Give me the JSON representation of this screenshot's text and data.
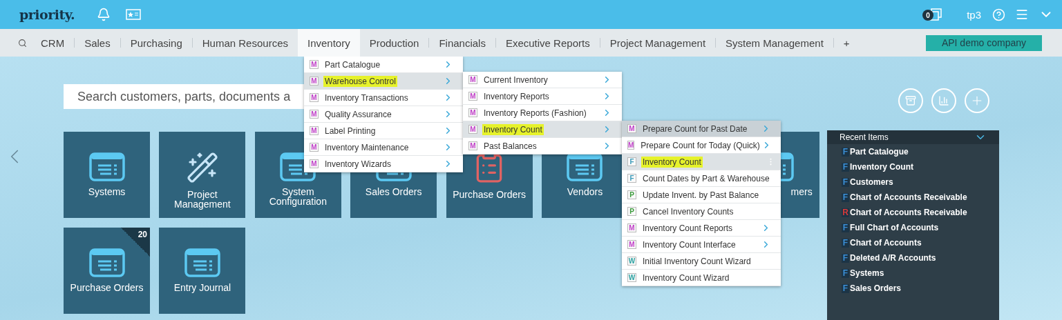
{
  "top_bar": {
    "logo": "priority.",
    "notifications": "0",
    "user": "tp3"
  },
  "nav": {
    "items": [
      {
        "label": "CRM",
        "selected": false
      },
      {
        "label": "Sales",
        "selected": false
      },
      {
        "label": "Purchasing",
        "selected": false
      },
      {
        "label": "Human Resources",
        "selected": false
      },
      {
        "label": "Inventory",
        "selected": true
      },
      {
        "label": "Production",
        "selected": false
      },
      {
        "label": "Financials",
        "selected": false
      },
      {
        "label": "Executive Reports",
        "selected": false
      },
      {
        "label": "Project Management",
        "selected": false
      },
      {
        "label": "System Management",
        "selected": false
      },
      {
        "label": "+",
        "selected": false
      }
    ],
    "company": "API demo company"
  },
  "search": {
    "placeholder": "Search customers, parts, documents a"
  },
  "tiles": [
    {
      "label": "Systems",
      "kind": "list"
    },
    {
      "label": "Project Management",
      "kind": "wand"
    },
    {
      "label": "System Configuration",
      "kind": "list"
    },
    {
      "label": "Sales Orders",
      "kind": "list"
    },
    {
      "label": "Purchase Orders",
      "kind": "checklist"
    },
    {
      "label": "Vendors",
      "kind": "list"
    },
    {
      "label": "mers",
      "kind": "clipped"
    },
    {
      "label": "Purchase Orders",
      "kind": "list",
      "badge": "20"
    },
    {
      "label": "Entry Journal",
      "kind": "list"
    }
  ],
  "recent": {
    "title": "Recent Items",
    "items": [
      {
        "tag": "F",
        "color": "#3b8fd6",
        "label": "Part Catalogue"
      },
      {
        "tag": "F",
        "color": "#3b8fd6",
        "label": "Inventory Count"
      },
      {
        "tag": "F",
        "color": "#3b8fd6",
        "label": "Customers"
      },
      {
        "tag": "F",
        "color": "#3b8fd6",
        "label": "Chart of Accounts Receivable"
      },
      {
        "tag": "R",
        "color": "#d83a3a",
        "label": "Chart of Accounts Receivable"
      },
      {
        "tag": "F",
        "color": "#3b8fd6",
        "label": "Full Chart of Accounts"
      },
      {
        "tag": "F",
        "color": "#3b8fd6",
        "label": "Chart of Accounts"
      },
      {
        "tag": "F",
        "color": "#3b8fd6",
        "label": "Deleted A/R Accounts"
      },
      {
        "tag": "F",
        "color": "#3b8fd6",
        "label": "Systems"
      },
      {
        "tag": "F",
        "color": "#3b8fd6",
        "label": "Sales Orders"
      }
    ]
  },
  "menus": [
    {
      "items": [
        {
          "type": "M",
          "color": "#c040c8",
          "label": "Part Catalogue",
          "submenu": true,
          "selected": false,
          "highlighted": false
        },
        {
          "type": "M",
          "color": "#c040c8",
          "label": "Warehouse Control",
          "submenu": true,
          "selected": true,
          "highlighted": true
        },
        {
          "type": "M",
          "color": "#c040c8",
          "label": "Inventory Transactions",
          "submenu": true,
          "selected": false,
          "highlighted": false
        },
        {
          "type": "M",
          "color": "#c040c8",
          "label": "Quality Assurance",
          "submenu": true,
          "selected": false,
          "highlighted": false
        },
        {
          "type": "M",
          "color": "#c040c8",
          "label": "Label Printing",
          "submenu": true,
          "selected": false,
          "highlighted": false
        },
        {
          "type": "M",
          "color": "#c040c8",
          "label": "Inventory Maintenance",
          "submenu": true,
          "selected": false,
          "highlighted": false
        },
        {
          "type": "M",
          "color": "#c040c8",
          "label": "Inventory Wizards",
          "submenu": true,
          "selected": false,
          "highlighted": false
        }
      ]
    },
    {
      "items": [
        {
          "type": "M",
          "color": "#c040c8",
          "label": "Current Inventory",
          "submenu": true,
          "selected": false,
          "highlighted": false
        },
        {
          "type": "M",
          "color": "#c040c8",
          "label": "Inventory Reports",
          "submenu": true,
          "selected": false,
          "highlighted": false
        },
        {
          "type": "M",
          "color": "#c040c8",
          "label": "Inventory Reports (Fashion)",
          "submenu": true,
          "selected": false,
          "highlighted": false
        },
        {
          "type": "M",
          "color": "#c040c8",
          "label": "Inventory Count",
          "submenu": true,
          "selected": true,
          "highlighted": true
        },
        {
          "type": "M",
          "color": "#c040c8",
          "label": "Past Balances",
          "submenu": true,
          "selected": false,
          "highlighted": false
        }
      ]
    },
    {
      "items": [
        {
          "type": "M",
          "color": "#c040c8",
          "label": "Prepare Count for Past Date",
          "submenu": true,
          "selected": false,
          "hovered": true,
          "highlighted": false
        },
        {
          "type": "M",
          "color": "#c040c8",
          "label": "Prepare Count for Today (Quick)",
          "submenu": true,
          "selected": false,
          "hovered": false,
          "highlighted": false
        },
        {
          "type": "F",
          "color": "#3a9ab8",
          "label": "Inventory Count",
          "submenu": false,
          "selected": true,
          "hovered": false,
          "highlighted": true
        },
        {
          "type": "F",
          "color": "#3a9ab8",
          "label": "Count Dates by Part & Warehouse",
          "submenu": false,
          "selected": false,
          "hovered": false,
          "highlighted": false
        },
        {
          "type": "P",
          "color": "#3a9a3a",
          "label": "Update Invent. by Past Balance",
          "submenu": false,
          "selected": false,
          "hovered": false,
          "highlighted": false
        },
        {
          "type": "P",
          "color": "#3a9a3a",
          "label": "Cancel Inventory Counts",
          "submenu": false,
          "selected": false,
          "hovered": false,
          "highlighted": false
        },
        {
          "type": "M",
          "color": "#c040c8",
          "label": "Inventory Count Reports",
          "submenu": true,
          "selected": false,
          "hovered": false,
          "highlighted": false
        },
        {
          "type": "M",
          "color": "#c040c8",
          "label": "Inventory Count Interface",
          "submenu": true,
          "selected": false,
          "hovered": false,
          "highlighted": false
        },
        {
          "type": "W",
          "color": "#2aa0a0",
          "label": "Initial Inventory Count Wizard",
          "submenu": false,
          "selected": false,
          "hovered": false,
          "highlighted": false
        },
        {
          "type": "W",
          "color": "#2aa0a0",
          "label": "Inventory Count Wizard",
          "submenu": false,
          "selected": false,
          "hovered": false,
          "highlighted": false
        }
      ]
    }
  ]
}
